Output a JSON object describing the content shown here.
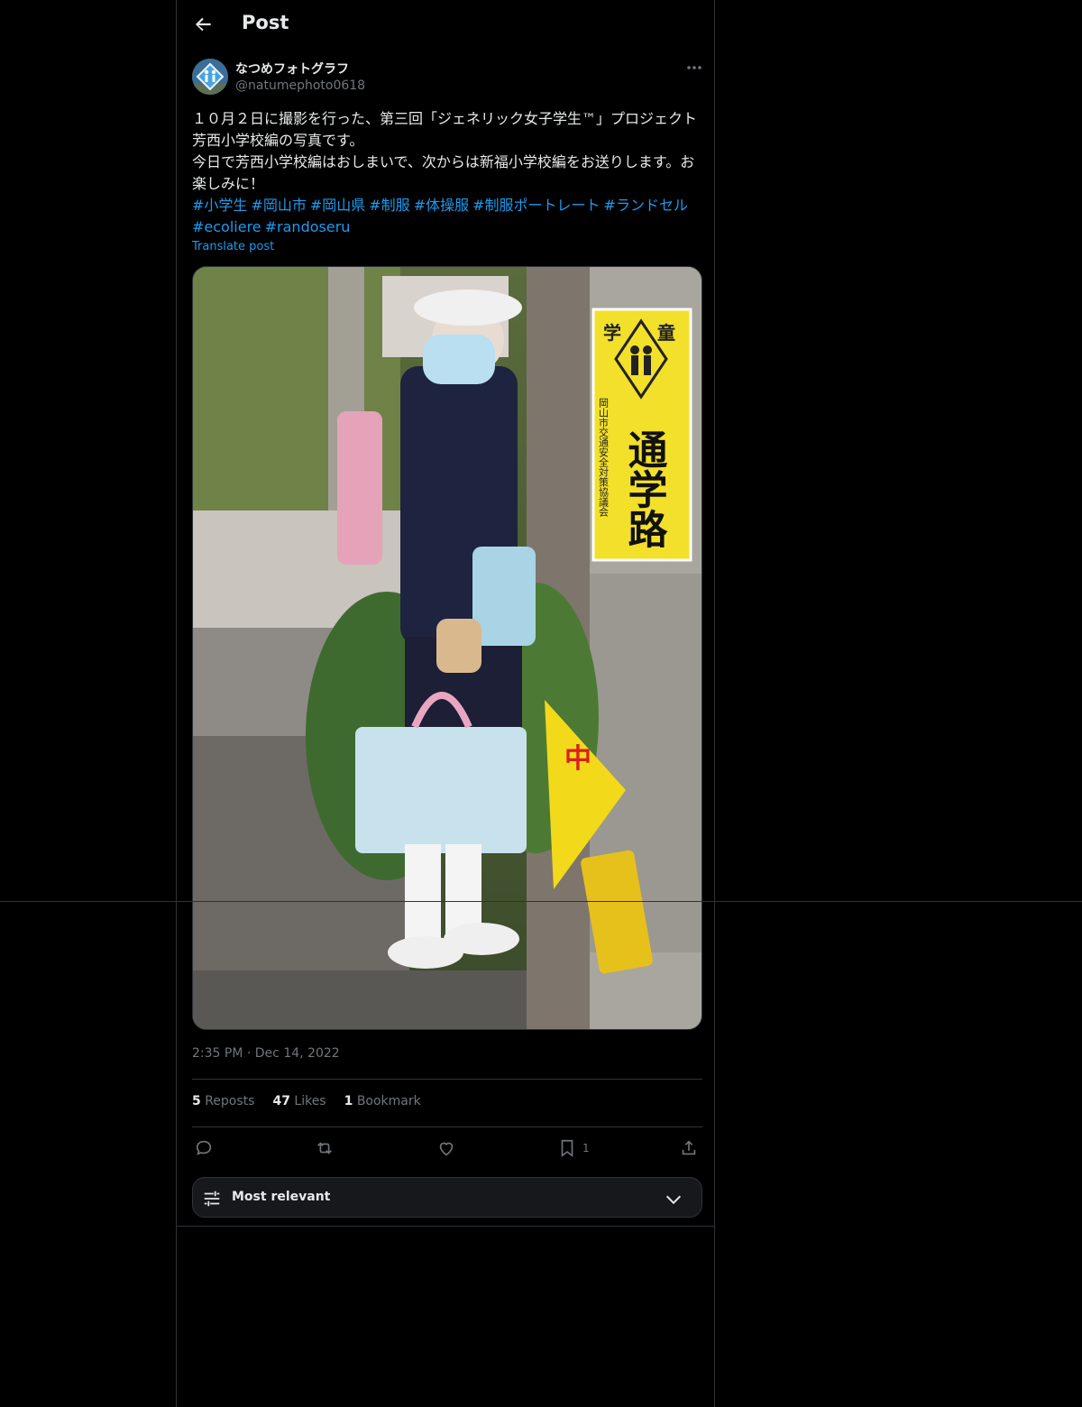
{
  "header": {
    "title": "Post",
    "back_icon": "arrow-left-icon"
  },
  "author": {
    "display_name": "なつめフォトグラフ",
    "handle": "@natumephoto0618",
    "avatar_icon": "school-crossing-icon"
  },
  "post": {
    "lines": [
      "１０月２日に撮影を行った、第三回「ジェネリック女子学生™」プロジェクト 芳西小学校編の写真です。",
      "今日で芳西小学校編はおしまいで、次からは新福小学校編をお送りします。お楽しみに！"
    ],
    "hashtags": [
      "#小学生",
      "#岡山市",
      "#岡山県",
      "#制服",
      "#体操服",
      "#制服ポートレート",
      "#ランドセル",
      "#ecoliere",
      "#randoseru"
    ],
    "translate_label": "Translate post",
    "sign_text": {
      "top_left": "学",
      "top_right": "童",
      "main": "通学路",
      "side": "岡山市交通安全対策協議会",
      "flag": "中"
    },
    "time": "2:35 PM",
    "separator": "·",
    "date": "Dec 14, 2022"
  },
  "stats": {
    "reposts_count": "5",
    "reposts_label": "Reposts",
    "likes_count": "47",
    "likes_label": "Likes",
    "bookmarks_count": "1",
    "bookmarks_label": "Bookmark"
  },
  "actions": {
    "reply_icon": "reply-icon",
    "repost_icon": "repost-icon",
    "like_icon": "heart-icon",
    "bookmark_icon": "bookmark-icon",
    "bookmark_count": "1",
    "share_icon": "share-icon"
  },
  "sort": {
    "label": "Most relevant",
    "icon": "sliders-icon"
  },
  "colors": {
    "background": "#000000",
    "text": "#e7e9ea",
    "muted": "#71767b",
    "link": "#1d9bf0",
    "border": "#2f3336"
  }
}
